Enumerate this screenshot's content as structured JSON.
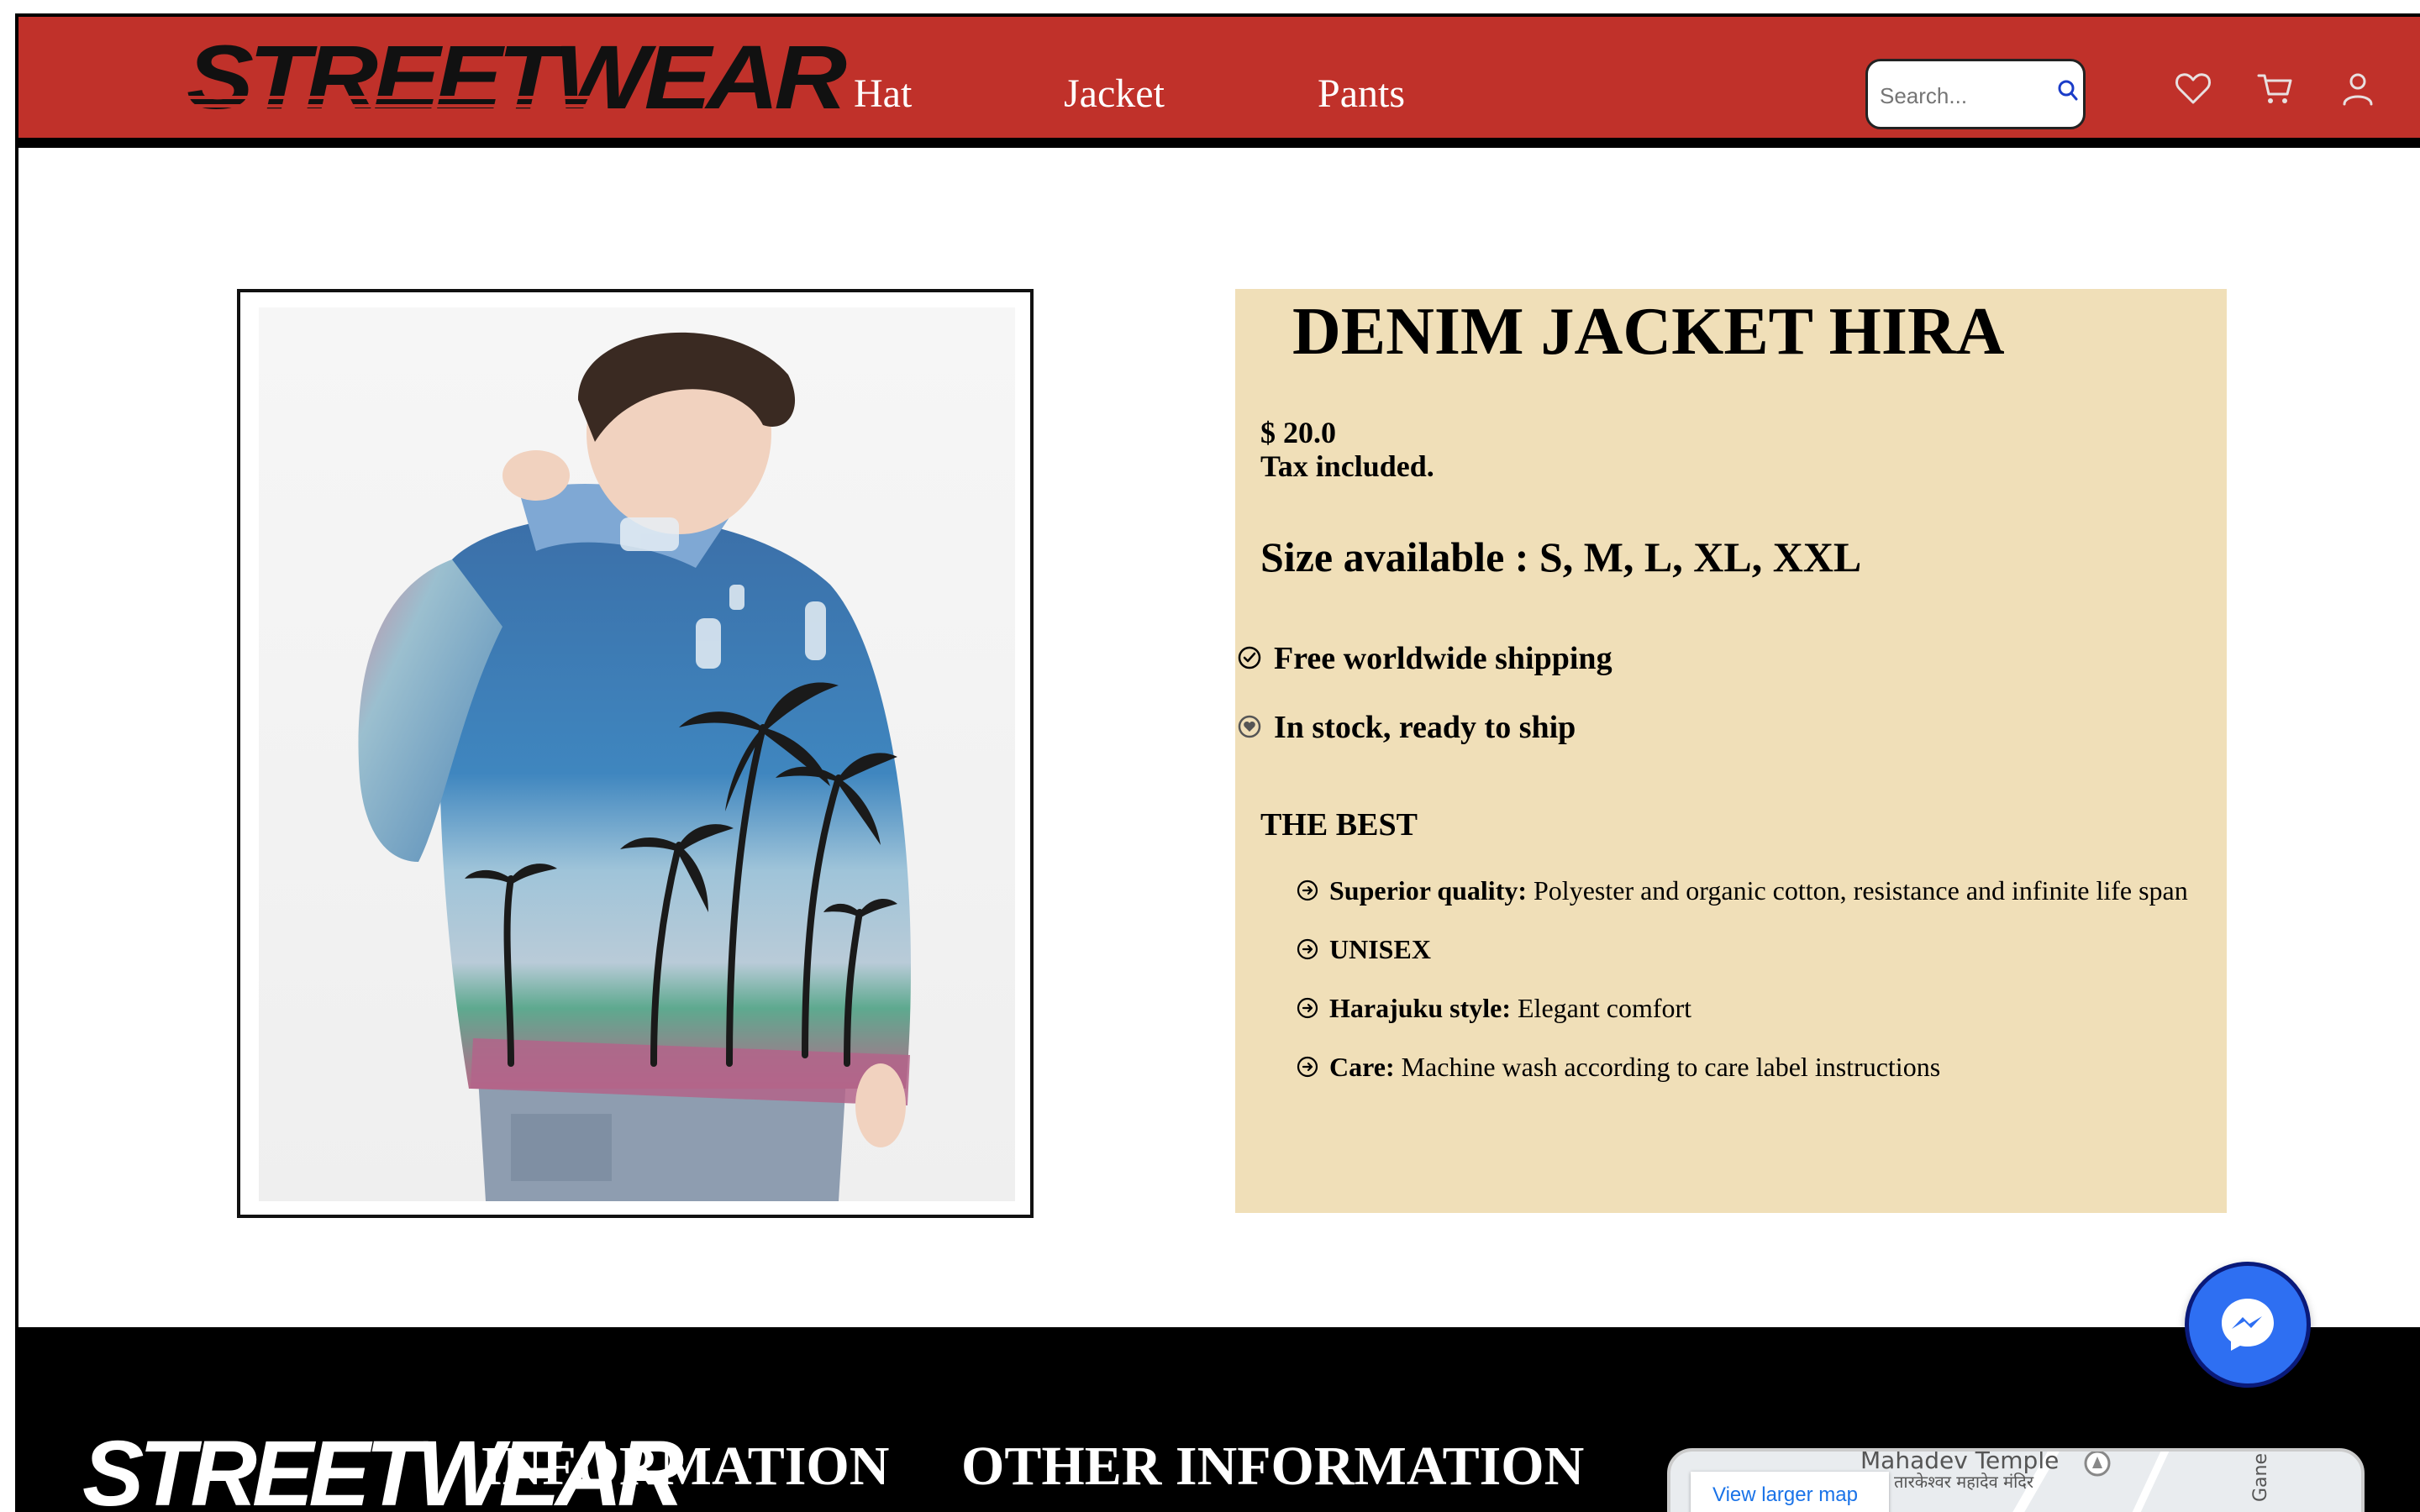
{
  "header": {
    "brand": "STREETWEAR",
    "nav": [
      {
        "label": "Hat"
      },
      {
        "label": "Jacket"
      },
      {
        "label": "Pants"
      }
    ],
    "search": {
      "placeholder": "Search..."
    },
    "icons": [
      "heart-icon",
      "cart-icon",
      "user-icon"
    ],
    "colors": {
      "bar": "#c0312a",
      "text": "#ffffff"
    }
  },
  "product": {
    "title": "DENIM JACKET HIRA",
    "price": "$ 20.0",
    "tax_note": "Tax included.",
    "sizes": "Size available : S, M, L, XL, XXL",
    "features": [
      {
        "icon": "check-circle-icon",
        "text": "Free worldwide shipping"
      },
      {
        "icon": "heart-circle-icon",
        "text": "In stock, ready to ship"
      }
    ],
    "best_heading": "THE BEST",
    "bullets": [
      {
        "label": "Superior quality:",
        "text": "Polyester and organic cotton, resistance and infinite life span"
      },
      {
        "label": "UNISEX",
        "text": ""
      },
      {
        "label": "Harajuku style:",
        "text": "Elegant comfort"
      },
      {
        "label": "Care:",
        "text": "Machine wash according to care label instructions"
      }
    ],
    "panel_color": "#f0dfb8"
  },
  "footer": {
    "brand": "STREETWEAR",
    "headings": [
      "INFORMATION",
      "OTHER INFORMATION"
    ],
    "map": {
      "link": "View larger map",
      "place": "Mahadev Temple",
      "place_local": "तारकेश्वर महादेव मंदिर",
      "side_label": "Gane"
    }
  },
  "messenger": {
    "icon": "messenger-icon",
    "color": "#2e6ff2"
  }
}
